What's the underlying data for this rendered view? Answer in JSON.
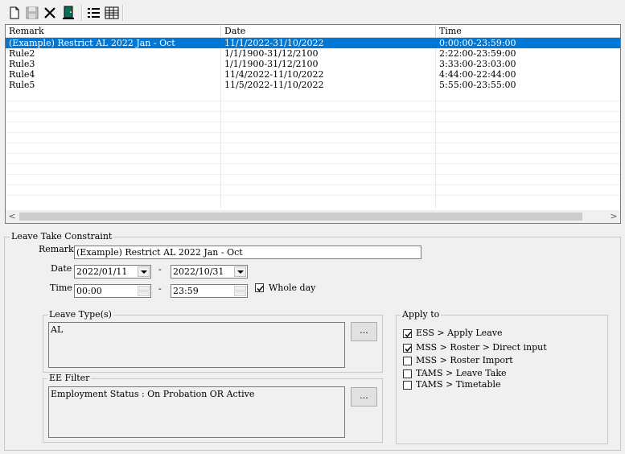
{
  "toolbar": {
    "icons": [
      "new-icon",
      "save-icon",
      "delete-icon",
      "exit-icon",
      "list-view-icon",
      "detail-view-icon"
    ]
  },
  "grid": {
    "columns": [
      "Remark",
      "Date",
      "Time"
    ],
    "rows": [
      {
        "remark": "(Example) Restrict AL 2022 Jan - Oct",
        "date": "11/1/2022-31/10/2022",
        "time": "0:00:00-23:59:00",
        "selected": true
      },
      {
        "remark": "Rule2",
        "date": "1/1/1900-31/12/2100",
        "time": "2:22:00-23:59:00",
        "selected": false
      },
      {
        "remark": "Rule3",
        "date": "1/1/1900-31/12/2100",
        "time": "3:33:00-23:03:00",
        "selected": false
      },
      {
        "remark": "Rule4",
        "date": "11/4/2022-11/10/2022",
        "time": "4:44:00-22:44:00",
        "selected": false
      },
      {
        "remark": "Rule5",
        "date": "11/5/2022-11/10/2022",
        "time": "5:55:00-23:55:00",
        "selected": false
      }
    ],
    "scroll_left": "<",
    "scroll_right": ">"
  },
  "constraint": {
    "title": "Leave Take Constraint",
    "remark_label": "Remark",
    "remark_value": "(Example) Restrict AL 2022 Jan - Oct",
    "date_label": "Date",
    "date_from": "2022/01/11",
    "date_sep": "-",
    "date_to": "2022/10/31",
    "time_label": "Time",
    "time_from": "00:00",
    "time_sep": "-",
    "time_to": "23:59",
    "whole_day_label": "Whole day",
    "whole_day_checked": true
  },
  "leave_type": {
    "title": "Leave Type(s)",
    "value": "AL",
    "button": "..."
  },
  "ee_filter": {
    "title": "EE Filter",
    "value": "Employment Status : On Probation OR Active",
    "button": "..."
  },
  "apply_to": {
    "title": "Apply to",
    "options": [
      {
        "label": "ESS > Apply Leave",
        "checked": true
      },
      {
        "label": "MSS > Roster > Direct input",
        "checked": true
      },
      {
        "label": "MSS > Roster Import",
        "checked": false
      },
      {
        "label": "TAMS > Leave Take",
        "checked": false
      },
      {
        "label": "TAMS > Timetable",
        "checked": false
      }
    ]
  }
}
